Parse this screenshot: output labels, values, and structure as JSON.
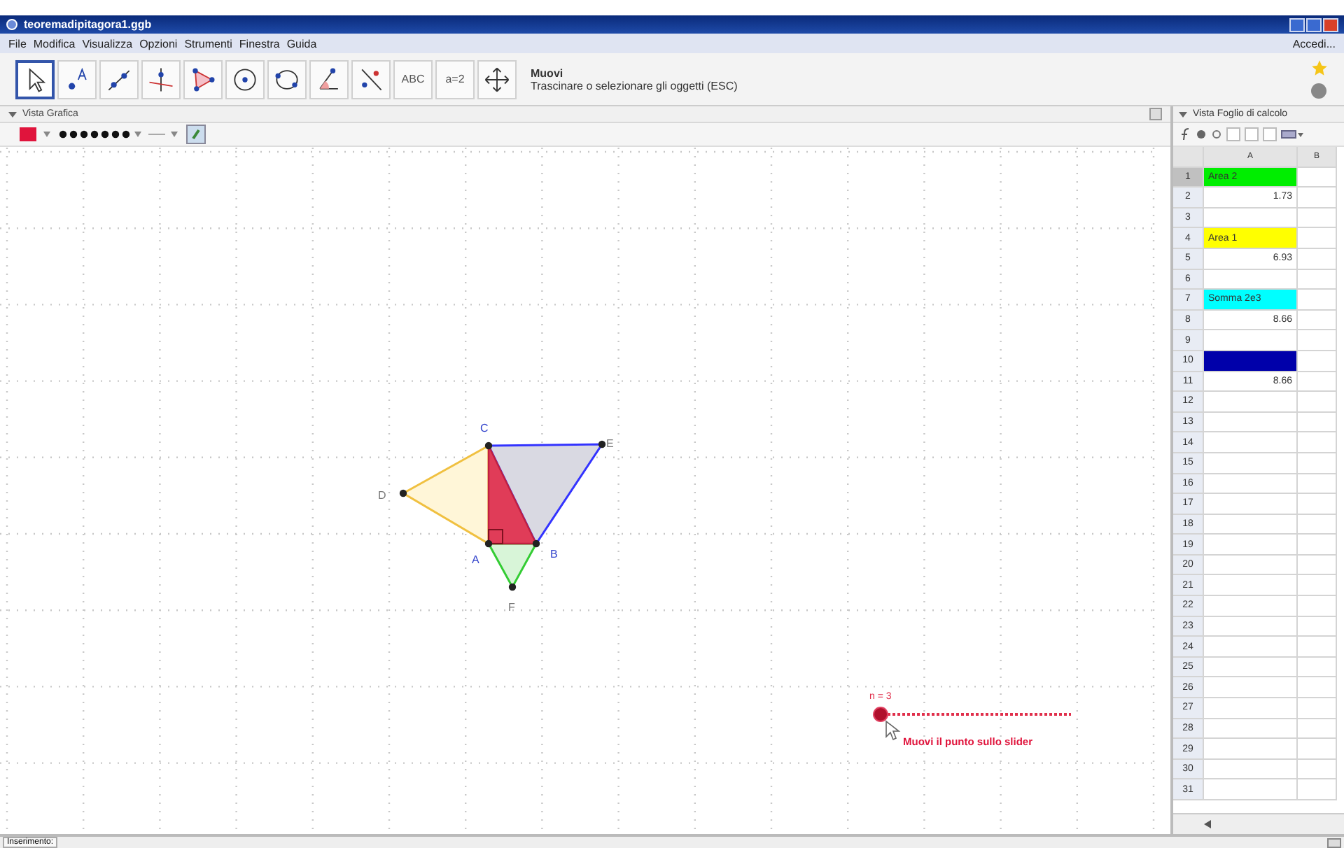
{
  "window": {
    "title": "teoremadipitagora1.ggb"
  },
  "menu": {
    "items": [
      "File",
      "Modifica",
      "Visualizza",
      "Opzioni",
      "Strumenti",
      "Finestra",
      "Guida"
    ],
    "login": "Accedi..."
  },
  "toolbar": {
    "tools": [
      {
        "kind": "move",
        "selected": true
      },
      {
        "kind": "point",
        "selected": false
      },
      {
        "kind": "line",
        "selected": false
      },
      {
        "kind": "perpendicular",
        "selected": false
      },
      {
        "kind": "polygon",
        "selected": false
      },
      {
        "kind": "circle",
        "selected": false
      },
      {
        "kind": "conic",
        "selected": false
      },
      {
        "kind": "angle",
        "selected": false
      },
      {
        "kind": "reflect",
        "selected": false
      },
      {
        "kind": "text",
        "label": "ABC",
        "selected": false
      },
      {
        "kind": "slider",
        "label": "a=2",
        "selected": false
      },
      {
        "kind": "pan",
        "selected": false
      }
    ],
    "tool_name": "Muovi",
    "tool_description": "Trascinare o selezionare gli oggetti (ESC)"
  },
  "graphics": {
    "title": "Vista Grafica",
    "points": [
      {
        "label": "C"
      },
      {
        "label": "E"
      },
      {
        "label": "D"
      },
      {
        "label": "A"
      },
      {
        "label": "B"
      },
      {
        "label": "F"
      }
    ],
    "slider": {
      "label": "n = 3",
      "hint": "Muovi il punto sullo slider"
    }
  },
  "spreadsheet": {
    "title": "Vista Foglio di calcolo",
    "columns": [
      "A",
      "B"
    ],
    "rows": [
      {
        "number": "1",
        "selected": true,
        "cell": {
          "text": "Area 2",
          "color": "#00ee00"
        }
      },
      {
        "number": "2",
        "selected": false,
        "cell": {
          "text": "1.73"
        }
      },
      {
        "number": "3",
        "selected": false
      },
      {
        "number": "4",
        "selected": false,
        "cell": {
          "text": "Area 1",
          "color": "#ffff00"
        }
      },
      {
        "number": "5",
        "selected": false,
        "cell": {
          "text": "6.93"
        }
      },
      {
        "number": "6",
        "selected": false
      },
      {
        "number": "7",
        "selected": false,
        "cell": {
          "text": "Somma 2e3",
          "color": "#00ffff"
        }
      },
      {
        "number": "8",
        "selected": false,
        "cell": {
          "text": "8.66"
        }
      },
      {
        "number": "9",
        "selected": false
      },
      {
        "number": "10",
        "selected": false,
        "cell": {
          "color": "#0000aa"
        }
      },
      {
        "number": "11",
        "selected": false,
        "cell": {
          "text": "8.66"
        }
      },
      {
        "number": "12",
        "selected": false
      },
      {
        "number": "13",
        "selected": false
      },
      {
        "number": "14",
        "selected": false
      },
      {
        "number": "15",
        "selected": false
      },
      {
        "number": "16",
        "selected": false
      },
      {
        "number": "17",
        "selected": false
      },
      {
        "number": "18",
        "selected": false
      },
      {
        "number": "19",
        "selected": false
      },
      {
        "number": "20",
        "selected": false
      },
      {
        "number": "21",
        "selected": false
      },
      {
        "number": "22",
        "selected": false
      },
      {
        "number": "23",
        "selected": false
      },
      {
        "number": "24",
        "selected": false
      },
      {
        "number": "25",
        "selected": false
      },
      {
        "number": "26",
        "selected": false
      },
      {
        "number": "27",
        "selected": false
      },
      {
        "number": "28",
        "selected": false
      },
      {
        "number": "29",
        "selected": false
      },
      {
        "number": "30",
        "selected": false
      },
      {
        "number": "31",
        "selected": false
      }
    ]
  },
  "input_bar": {
    "label": "Inserimento:"
  }
}
